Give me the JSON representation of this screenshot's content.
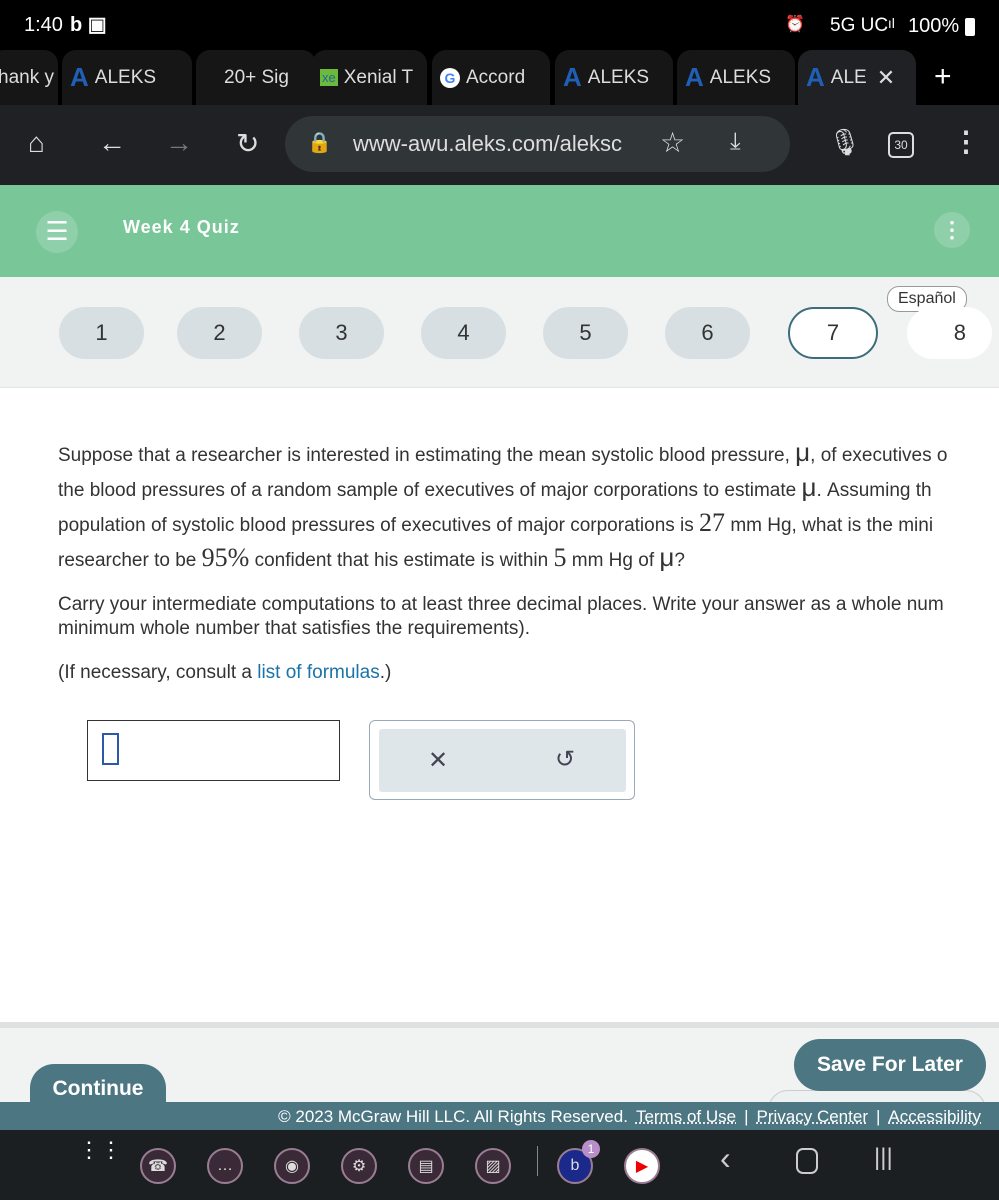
{
  "status_bar": {
    "time": "1:40",
    "network": "5G UC",
    "battery": "100%"
  },
  "tabs": [
    {
      "label": "hank y"
    },
    {
      "label": "ALEKS"
    },
    {
      "label": "20+ Sig"
    },
    {
      "label": "Xenial T"
    },
    {
      "label": "Accord"
    },
    {
      "label": "ALEKS"
    },
    {
      "label": "ALEKS"
    },
    {
      "label": "ALE"
    }
  ],
  "toolbar": {
    "url": "www-awu.aleks.com/aleksc",
    "tab_count": "30"
  },
  "header": {
    "title": "Week 4 Quiz"
  },
  "question_nav": {
    "language": "Español",
    "items": [
      "1",
      "2",
      "3",
      "4",
      "5",
      "6",
      "7",
      "8"
    ],
    "current": "7"
  },
  "question": {
    "line1a": "Suppose that a researcher is interested in estimating the mean systolic blood pressure, ",
    "mu": "μ",
    "line1b": ", of executives o",
    "line2a": "the blood pressures of a random sample of executives of major corporations to estimate ",
    "line2b": ". Assuming th",
    "line3a": "population of systolic blood pressures of executives of major corporations is ",
    "sd": "27",
    "line3b": " mm Hg, what is the mini",
    "line4a": "researcher to be ",
    "conf": "95%",
    "line4b": " confident that his estimate is within ",
    "margin": "5",
    "line4c": " mm Hg of ",
    "line4d": "?",
    "instr1": "Carry your intermediate computations to at least three decimal places. Write your answer as a whole num",
    "instr2": "minimum whole number that satisfies the requirements).",
    "consult_a": "(If necessary, consult a ",
    "consult_link": "list of formulas",
    "consult_b": ".)"
  },
  "answer": {
    "value": ""
  },
  "buttons": {
    "continue": "Continue",
    "save": "Save For Later"
  },
  "footer": {
    "copyright": "© 2023 McGraw Hill LLC. All Rights Reserved.",
    "terms": "Terms of Use",
    "privacy": "Privacy Center",
    "accessibility": "Accessibility"
  },
  "navbar": {
    "badge": "1"
  },
  "colors": {
    "header": "#79c698",
    "accent": "#4d7683",
    "link": "#1a73a8"
  }
}
